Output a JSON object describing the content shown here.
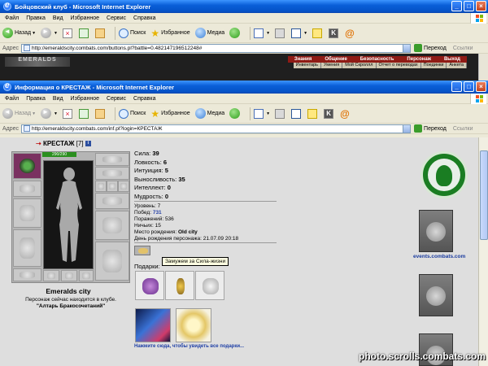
{
  "back_window": {
    "title": "Бойцовский клуб - Microsoft Internet Explorer",
    "menu": [
      "Файл",
      "Правка",
      "Вид",
      "Избранное",
      "Сервис",
      "Справка"
    ],
    "toolbar": {
      "back": "Назад",
      "search": "Поиск",
      "favorites": "Избранное",
      "media": "Медиа"
    },
    "address_label": "Адрес",
    "address": "http://emeraldscity.combats.com/buttons.pl?battle=0.48214719651224​8#",
    "go": "Переход",
    "links": "Ссылки",
    "logo": "EMERALDS",
    "nav_top": [
      "Знания",
      "Общение",
      "Безопасность",
      "Персонаж",
      "Выход"
    ],
    "nav_bottom": [
      "Инвентарь",
      "Умения",
      "Мой Скроллл",
      "Отчет о переводах",
      "Поединки",
      "Анкета"
    ]
  },
  "front_window": {
    "title": "Информация о КРЕСТАЖ - Microsoft Internet Explorer",
    "menu": [
      "Файл",
      "Правка",
      "Вид",
      "Избранное",
      "Сервис",
      "Справка"
    ],
    "toolbar": {
      "back": "Назад",
      "search": "Поиск",
      "favorites": "Избранное",
      "media": "Медиа"
    },
    "address_label": "Адрес",
    "address": "http://emeraldscity.combats.com/inf.pl?login=КРЕСТАЖ",
    "go": "Переход",
    "links": "Ссылки"
  },
  "character": {
    "name": "КРЕСТАЖ",
    "level": "[7]",
    "info_icon": "i",
    "hp": "290/290",
    "stats": [
      {
        "label": "Сила:",
        "value": "39"
      },
      {
        "label": "Ловкость:",
        "value": "6"
      },
      {
        "label": "Интуиция:",
        "value": "5"
      },
      {
        "label": "Выносливость:",
        "value": "35"
      },
      {
        "label": "Интеллект:",
        "value": "0"
      },
      {
        "label": "Мудрость:",
        "value": "0"
      }
    ],
    "details": {
      "level": "Уровень: 7",
      "wins_label": "Побед:",
      "wins": "731",
      "losses": "Поражений: 536",
      "draws": "Ничьих: 15",
      "birthplace_label": "Место рождения:",
      "birthplace": "Old city",
      "birthday": "День рождения персонажа: 21.07.09 20:18"
    },
    "city": "Emeralds city",
    "located_line1": "Персонаж сейчас находится в клубе.",
    "located_line2": "\"Алтарь Бракосочетаний\"",
    "tooltip": "Замужем за Сила-жизни",
    "gifts_label": "Подарки:",
    "see_all_gifts": "Нажмите сюда, чтобы увидеть все подарки..."
  },
  "right_links": {
    "events": "events.combats.com"
  },
  "watermark": "photo.scrolls.combats.com",
  "colors": {
    "xp_title": "#0553c8",
    "hp_green": "#2b8f1f",
    "link_blue": "#1e3fa6",
    "back_nav_red": "#8f1b15"
  }
}
